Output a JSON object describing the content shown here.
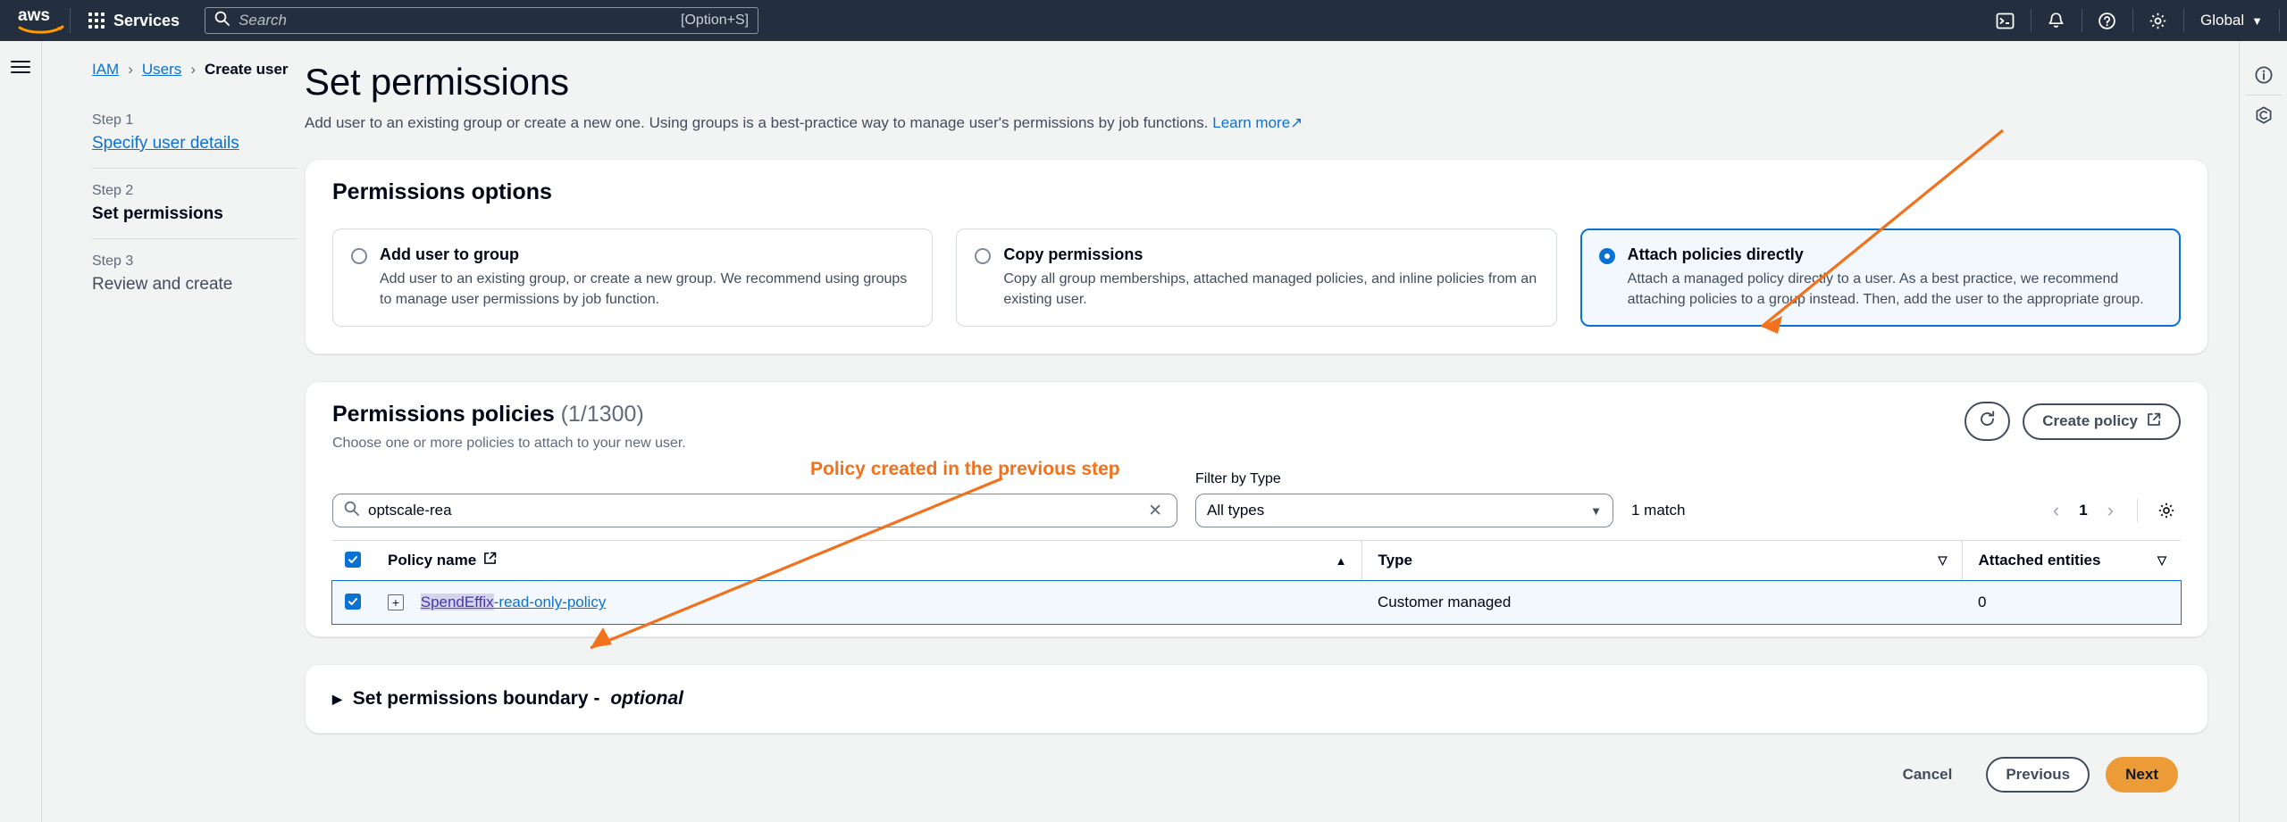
{
  "topnav": {
    "logo_alt": "aws",
    "services_label": "Services",
    "search_placeholder": "Search",
    "search_value": "",
    "search_shortcut": "[Option+S]",
    "icons": [
      "cloudshell-icon",
      "bell-icon",
      "help-icon",
      "settings-icon"
    ],
    "region_label": "Global",
    "region_caret": "▼"
  },
  "breadcrumb": {
    "items": [
      {
        "label": "IAM",
        "link": true
      },
      {
        "label": "Users",
        "link": true
      },
      {
        "label": "Create user",
        "link": false
      }
    ],
    "separator": "›"
  },
  "steps": [
    {
      "num": "Step 1",
      "name": "Specify user details",
      "state": "link"
    },
    {
      "num": "Step 2",
      "name": "Set permissions",
      "state": "active"
    },
    {
      "num": "Step 3",
      "name": "Review and create",
      "state": "upcoming"
    }
  ],
  "page": {
    "title": "Set permissions",
    "description": "Add user to an existing group or create a new one. Using groups is a best-practice way to manage user's permissions by job functions.",
    "learn_more": "Learn more"
  },
  "permissions_options": {
    "title": "Permissions options",
    "options": [
      {
        "label": "Add user to group",
        "description": "Add user to an existing group, or create a new group. We recommend using groups to manage user permissions by job function.",
        "selected": false
      },
      {
        "label": "Copy permissions",
        "description": "Copy all group memberships, attached managed policies, and inline policies from an existing user.",
        "selected": false
      },
      {
        "label": "Attach policies directly",
        "description": "Attach a managed policy directly to a user. As a best practice, we recommend attaching policies to a group instead. Then, add the user to the appropriate group.",
        "selected": true
      }
    ]
  },
  "permissions_policies": {
    "title": "Permissions policies",
    "count": "(1/1300)",
    "subtitle": "Choose one or more policies to attach to your new user.",
    "refresh_label": "refresh-icon",
    "create_policy_label": "Create policy",
    "search_value": "optscale-rea",
    "search_placeholder": "Search",
    "filter_label": "Filter by Type",
    "filter_value": "All types",
    "match_text": "1 match",
    "page_number": "1",
    "columns": [
      "Policy name",
      "Type",
      "Attached entities"
    ],
    "rows": [
      {
        "selected": true,
        "policy_name_prefix": "SpendEffix",
        "policy_name_rest": "-read-only-policy",
        "type": "Customer managed",
        "attached_entities": "0"
      }
    ]
  },
  "boundary": {
    "label": "Set permissions boundary - ",
    "optional": "optional"
  },
  "footer": {
    "cancel": "Cancel",
    "previous": "Previous",
    "next": "Next"
  },
  "annotations": {
    "policy_note": "Policy created in the previous step"
  },
  "colors": {
    "accent_blue": "#0972d3",
    "nav_bg": "#232f3e",
    "orange": "#ec9b37",
    "annotation": "#f2711c"
  }
}
